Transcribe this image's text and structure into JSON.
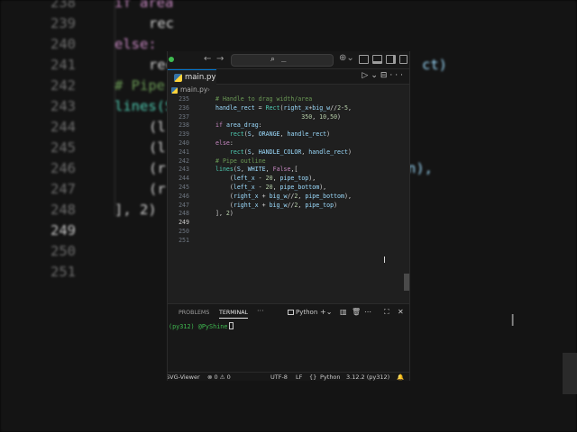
{
  "background": {
    "lines": [
      {
        "num": "238",
        "code": "if area"
      },
      {
        "num": "239",
        "code": "rec"
      },
      {
        "num": "240",
        "code": "else:"
      },
      {
        "num": "241",
        "code": "rec",
        "tail": "ct)"
      },
      {
        "num": "242",
        "code": "# Pipe"
      },
      {
        "num": "243",
        "code": "lines(S"
      },
      {
        "num": "244",
        "code": "(l"
      },
      {
        "num": "245",
        "code": "(l"
      },
      {
        "num": "246",
        "code": "(r",
        "tail": "n),"
      },
      {
        "num": "247",
        "code": "(r"
      },
      {
        "num": "248",
        "code": "], 2)"
      },
      {
        "num": "249",
        "code": ""
      },
      {
        "num": "250",
        "code": ""
      },
      {
        "num": "251",
        "code": ""
      }
    ]
  },
  "titlebar": {
    "back": "←",
    "forward": "→",
    "search_text": "_"
  },
  "tab": {
    "label": "main.py",
    "run": "▷",
    "run_menu": "⌄",
    "split": "⊟",
    "more": "···"
  },
  "breadcrumb": {
    "file": "main.py",
    "chevron": "›"
  },
  "editor": {
    "lines": [
      {
        "num": "235",
        "html": "<span class='cm'># Handle to drag width/area</span>"
      },
      {
        "num": "236",
        "html": "<span class='var'>handle_rect</span> = <span class='fn'>Rect</span>(<span class='var'>right_x</span>+<span class='var'>big_w</span>//<span class='num'>2</span>-<span class='num'>5</span>,"
      },
      {
        "num": "237",
        "html": "                        <span class='num'>350</span>, <span class='num'>10</span>,<span class='num'>50</span>)"
      },
      {
        "num": "238",
        "html": "<span class='kw'>if</span> <span class='var'>area_drag</span>:"
      },
      {
        "num": "239",
        "html": "    <span class='fn'>rect</span>(<span class='var'>S</span>, <span class='var'>ORANGE</span>, <span class='var'>handle_rect</span>)"
      },
      {
        "num": "240",
        "html": "<span class='kw'>else</span>:"
      },
      {
        "num": "241",
        "html": "    <span class='fn'>rect</span>(<span class='var'>S</span>, <span class='var'>HANDLE_COLOR</span>, <span class='var'>handle_rect</span>)"
      },
      {
        "num": "242",
        "html": "<span class='cm'># Pipe outline</span>"
      },
      {
        "num": "243",
        "html": "<span class='fn'>lines</span>(<span class='var'>S</span>, <span class='var'>WHITE</span>, <span class='kw'>False</span>,["
      },
      {
        "num": "244",
        "html": "    (<span class='var'>left_x</span> - <span class='num'>20</span>, <span class='var'>pipe_top</span>),"
      },
      {
        "num": "245",
        "html": "    (<span class='var'>left_x</span> - <span class='num'>20</span>, <span class='var'>pipe_bottom</span>),"
      },
      {
        "num": "246",
        "html": "    (<span class='var'>right_x</span> + <span class='var'>big_w</span>//<span class='num'>2</span>, <span class='var'>pipe_bottom</span>),"
      },
      {
        "num": "247",
        "html": "    (<span class='var'>right_x</span> + <span class='var'>big_w</span>//<span class='num'>2</span>, <span class='var'>pipe_top</span>)"
      },
      {
        "num": "248",
        "html": "], <span class='num'>2</span>)"
      },
      {
        "num": "249",
        "html": "",
        "active": true
      },
      {
        "num": "250",
        "html": ""
      },
      {
        "num": "251",
        "html": ""
      }
    ]
  },
  "panel": {
    "problems": "PROBLEMS",
    "terminal": "TERMINAL",
    "more": "···",
    "terminal_name": "Python",
    "prompt": "(py312) @PyShine"
  },
  "statusbar": {
    "remote": "SVG-Viewer",
    "problems": "⊗ 0 ⚠ 0",
    "encoding": "UTF-8",
    "eol": "LF",
    "language_brace": "{}",
    "language": "Python",
    "interpreter": "3.12.2 (py312)",
    "bell": "🔔"
  }
}
